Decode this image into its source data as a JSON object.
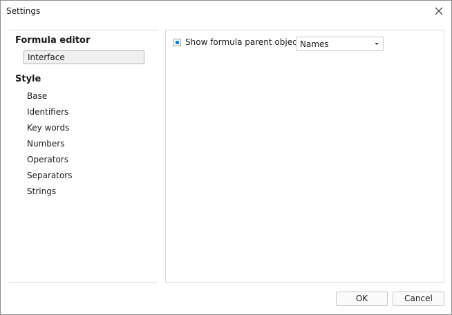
{
  "window": {
    "title": "Settings"
  },
  "sidebar": {
    "sections": [
      {
        "title": "Formula editor",
        "items": [
          {
            "label": "Interface",
            "selected": true
          }
        ]
      },
      {
        "title": "Style",
        "items": [
          {
            "label": "Base"
          },
          {
            "label": "Identifiers"
          },
          {
            "label": "Key words"
          },
          {
            "label": "Numbers"
          },
          {
            "label": "Operators"
          },
          {
            "label": "Separators"
          },
          {
            "label": "Strings"
          }
        ]
      }
    ]
  },
  "interface": {
    "show_parent_objects": {
      "label": "Show formula parent objects as",
      "checked": true
    },
    "parent_objects_select": {
      "value": "Names"
    }
  },
  "footer": {
    "ok_label": "OK",
    "cancel_label": "Cancel"
  },
  "colors": {
    "accent": "#1e7fd0",
    "selection_bg": "#f0f0f0",
    "border": "#d9d9d9"
  },
  "icons": {
    "close": "close-icon",
    "dropdown": "chevron-down-icon"
  }
}
